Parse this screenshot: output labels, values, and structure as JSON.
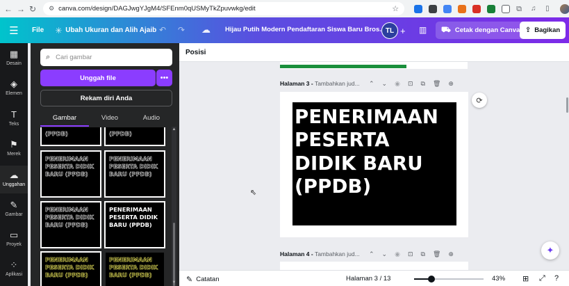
{
  "browser": {
    "url": "canva.com/design/DAGJwgYJgM4/SFEnm0qUSMyTkZpuvwkg/edit"
  },
  "header": {
    "file_label": "File",
    "resize_label": "Ubah Ukuran dan Alih Ajaib",
    "doc_title": "Hijau Putih Modern Pendaftaran Siswa Baru Bros...",
    "avatar_initials": "TL",
    "print_label": "Cetak dengan Canva",
    "share_label": "Bagikan"
  },
  "rail": {
    "items": [
      {
        "label": "Desain",
        "icon": "layout-icon"
      },
      {
        "label": "Elemen",
        "icon": "shapes-icon"
      },
      {
        "label": "Teks",
        "icon": "text-icon"
      },
      {
        "label": "Merek",
        "icon": "brand-icon"
      },
      {
        "label": "Unggahan",
        "icon": "cloud-upload-icon"
      },
      {
        "label": "Gambar",
        "icon": "draw-icon"
      },
      {
        "label": "Proyek",
        "icon": "folder-icon"
      },
      {
        "label": "Aplikasi",
        "icon": "apps-icon"
      }
    ],
    "active": "Unggahan"
  },
  "panel": {
    "search_placeholder": "Cari gambar",
    "upload_label": "Unggah file",
    "more_label": "•••",
    "record_label": "Rekam diri Anda",
    "tabs": [
      "Gambar",
      "Video",
      "Audio"
    ],
    "active_tab": "Gambar",
    "thumbs": [
      {
        "text": "(PPDB)",
        "style": "outline"
      },
      {
        "text": "(PPDB)",
        "style": "outline"
      },
      {
        "text": "PENERIMAAN PESERTA DIDIK BARU (PPDB)",
        "style": "outline"
      },
      {
        "text": "PENERIMAAN PESERTA DIDIK BARU (PPDB)",
        "style": "outline"
      },
      {
        "text": "PENERIMAAN PESERTA DIDIK BARU (PPDB)",
        "style": "outline"
      },
      {
        "text": "PENERIMAAN PESERTA DIDIK BARU (PPDB)",
        "style": "solid"
      },
      {
        "text": "PENERIMAAN PESERTA DIDIK BARU (PPDB)",
        "style": "yellow"
      },
      {
        "text": "PENERIMAAN PESERTA DIDIK BARU (PPDB)",
        "style": "yellow"
      }
    ]
  },
  "editor": {
    "toolbar_label": "Posisi",
    "page3_label": "Halaman 3 -",
    "page3_sub": "Tambahkan jud...",
    "page4_label": "Halaman 4 -",
    "page4_sub": "Tambahkan jud...",
    "page_title": "PENERIMAAN PESERTA DIDIK BARU (PPDB)"
  },
  "footer": {
    "notes_label": "Catatan",
    "page_indicator": "Halaman 3 / 13",
    "zoom_fraction": 0.25,
    "zoom_label": "43%"
  },
  "colors": {
    "accent": "#8b3dff",
    "header_start": "#00c4cc",
    "header_end": "#7d2ae8"
  }
}
